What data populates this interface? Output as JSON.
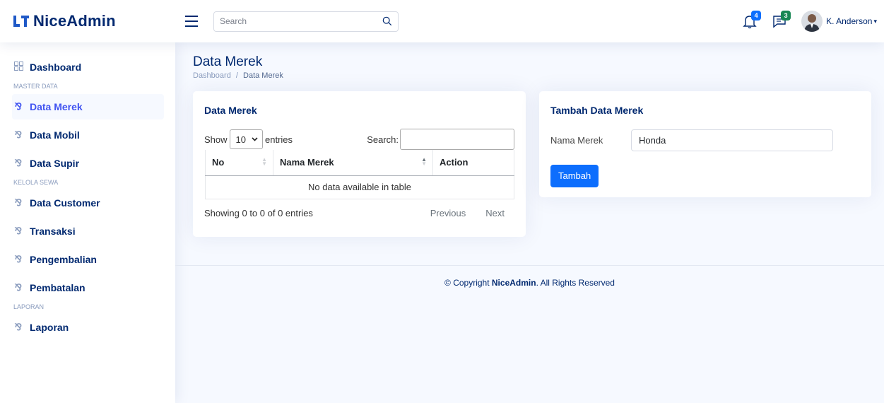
{
  "header": {
    "logo_text": "NiceAdmin",
    "search_placeholder": "Search",
    "notifications_count": "4",
    "messages_count": "3",
    "user_name": "K. Anderson"
  },
  "sidebar": {
    "dashboard": "Dashboard",
    "heading_master": "MASTER DATA",
    "items_master": [
      "Data Merek",
      "Data Mobil",
      "Data Supir"
    ],
    "heading_sewa": "KELOLA SEWA",
    "items_sewa": [
      "Data Customer",
      "Transaksi",
      "Pengembalian",
      "Pembatalan"
    ],
    "heading_laporan": "LAPORAN",
    "items_laporan": [
      "Laporan"
    ]
  },
  "page": {
    "title": "Data Merek",
    "breadcrumb_home": "Dashboard",
    "breadcrumb_sep": "/",
    "breadcrumb_current": "Data Merek"
  },
  "table_card": {
    "title": "Data Merek",
    "show_label": "Show",
    "length_value": "10",
    "entries_label": "entries",
    "search_label": "Search:",
    "columns": [
      "No",
      "Nama Merek",
      "Action"
    ],
    "empty_text": "No data available in table",
    "info": "Showing 0 to 0 of 0 entries",
    "prev": "Previous",
    "next": "Next"
  },
  "form_card": {
    "title": "Tambah Data Merek",
    "field_label": "Nama Merek",
    "field_value": "Honda",
    "submit": "Tambah"
  },
  "footer": {
    "prefix": "© Copyright ",
    "brand": "NiceAdmin",
    "suffix": ". All Rights Reserved"
  },
  "colors": {
    "primary": "#0d6efd",
    "navy": "#012970",
    "active": "#4154f1",
    "muted": "#899bbd"
  }
}
